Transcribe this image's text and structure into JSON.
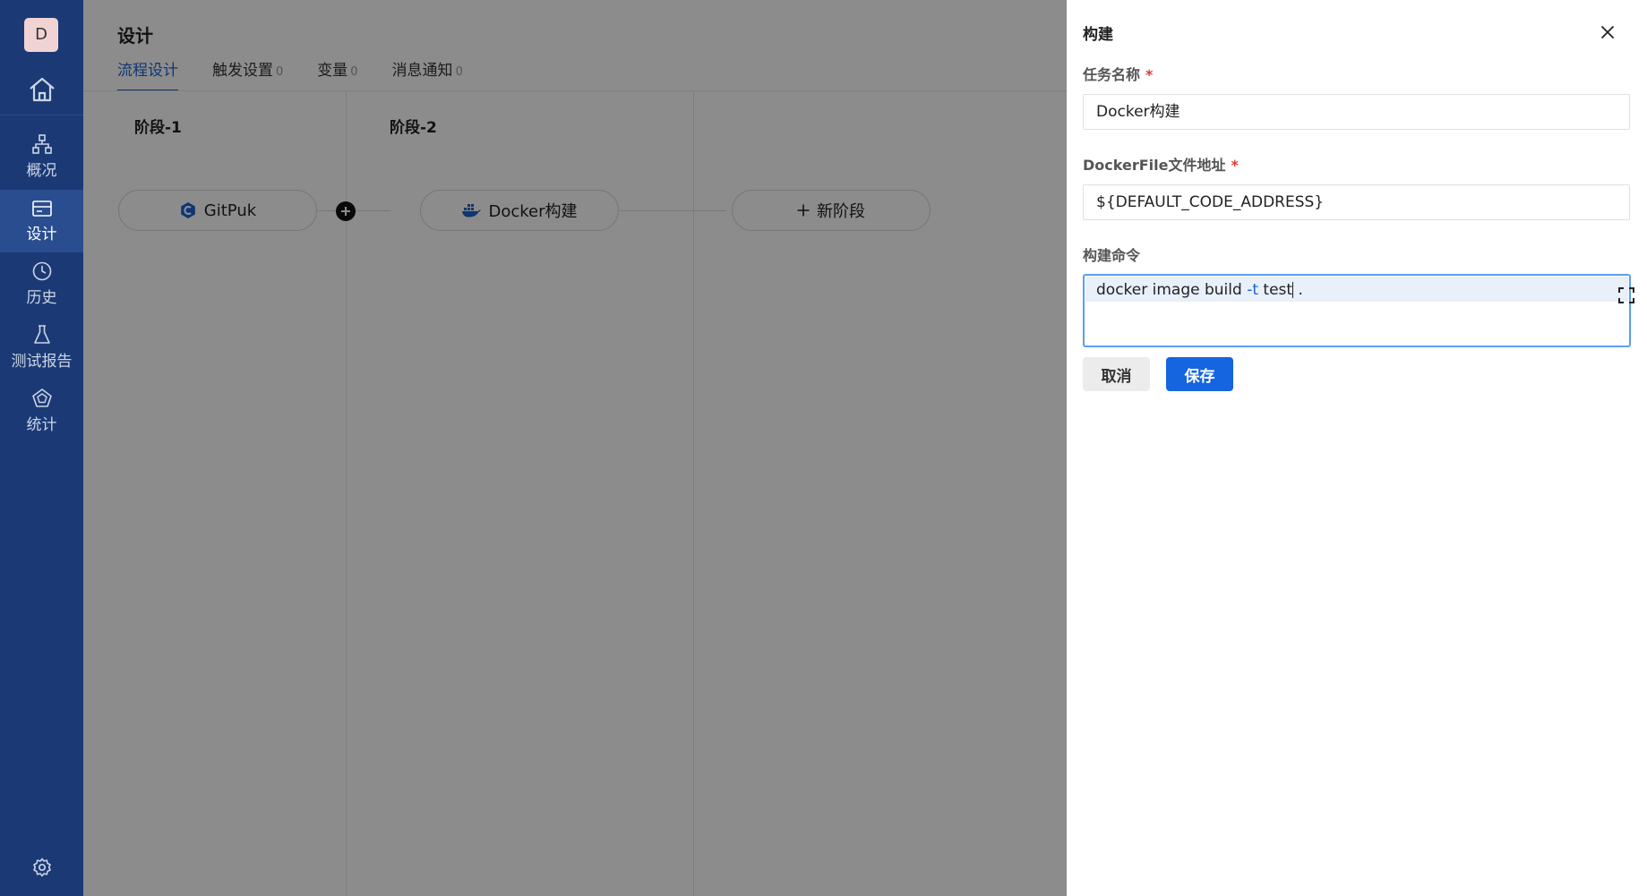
{
  "sidebar": {
    "avatar": "D",
    "items": [
      {
        "label": "概况",
        "icon": "sitemap-icon"
      },
      {
        "label": "设计",
        "icon": "layout-card-icon"
      },
      {
        "label": "历史",
        "icon": "clock-icon"
      },
      {
        "label": "测试报告",
        "icon": "flask-icon"
      },
      {
        "label": "统计",
        "icon": "pentagon-chart-icon"
      }
    ],
    "active_item": "设计"
  },
  "main": {
    "title": "设计",
    "tabs": [
      {
        "label": "流程设计",
        "count": ""
      },
      {
        "label": "触发设置",
        "count": "0"
      },
      {
        "label": "变量",
        "count": "0"
      },
      {
        "label": "消息通知",
        "count": "0"
      }
    ],
    "active_tab": "流程设计",
    "stages": [
      {
        "title": "阶段-1",
        "task": "GitPuk"
      },
      {
        "title": "阶段-2",
        "task": "Docker构建"
      }
    ],
    "add_stage_label": "新阶段"
  },
  "drawer": {
    "title": "构建",
    "fields": {
      "task_name": {
        "label": "任务名称",
        "value": "Docker构建"
      },
      "dockerfile": {
        "label": "DockerFile文件地址",
        "value": "${DEFAULT_CODE_ADDRESS}"
      },
      "command": {
        "label": "构建命令",
        "part1": "docker image build ",
        "part2": "-t",
        "part3": " test",
        "part4": " ."
      }
    },
    "cancel_label": "取消",
    "save_label": "保存"
  },
  "colors": {
    "sidebar_bg": "#1b3a75",
    "accent": "#1565e0",
    "required": "#e53935"
  }
}
